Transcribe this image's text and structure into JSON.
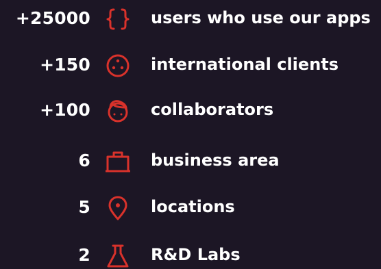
{
  "accent_color": "#d9322b",
  "stats": [
    {
      "value": "+25000",
      "label": "users who use our apps",
      "icon": "curly-braces-icon"
    },
    {
      "value": "+150",
      "label": "international clients",
      "icon": "globe-dots-icon"
    },
    {
      "value": "+100",
      "label": "collaborators",
      "icon": "person-face-icon"
    },
    {
      "value": "6",
      "label": "business area",
      "icon": "briefcase-icon"
    },
    {
      "value": "5",
      "label": "locations",
      "icon": "map-pin-icon"
    },
    {
      "value": "2",
      "label": "R&D Labs",
      "icon": "flask-icon"
    }
  ]
}
